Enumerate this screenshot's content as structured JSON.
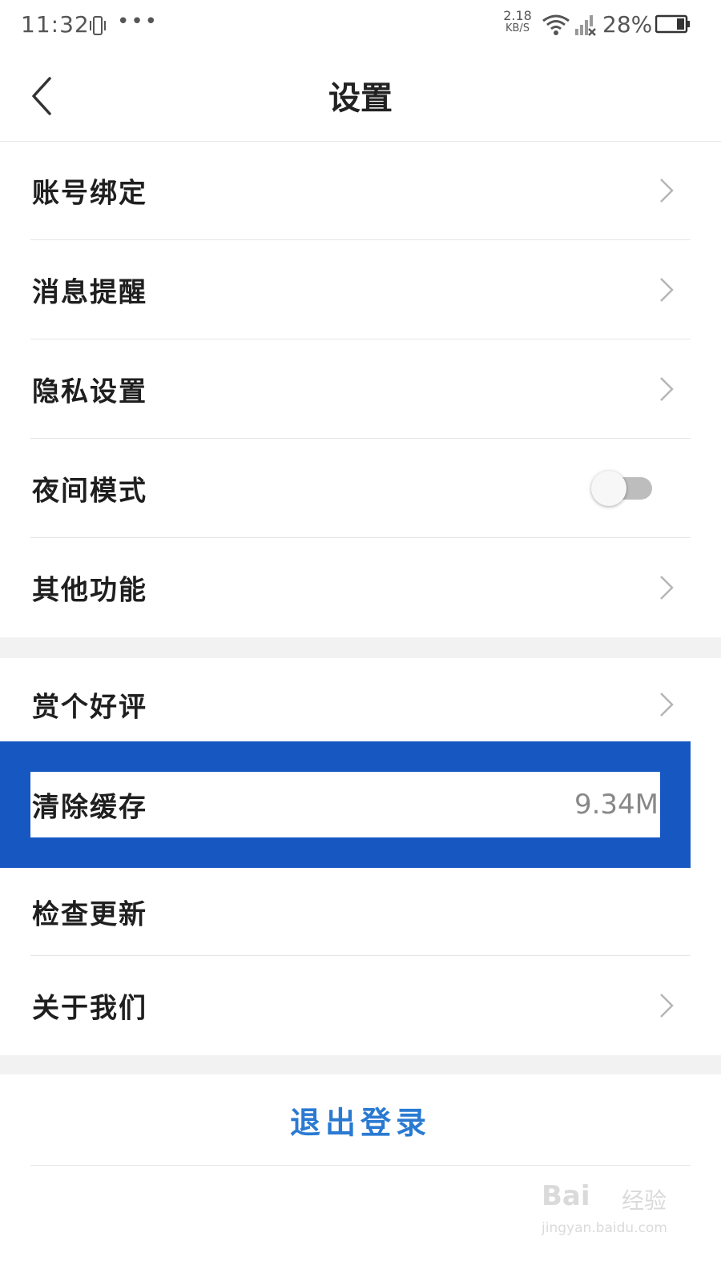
{
  "status_bar": {
    "time": "11:32",
    "dots": "•••",
    "net_speed_value": "2.18",
    "net_speed_unit": "KB/S",
    "battery_percent": "28%"
  },
  "header": {
    "title": "设置"
  },
  "groups": {
    "main": [
      {
        "label": "账号绑定"
      },
      {
        "label": "消息提醒"
      },
      {
        "label": "隐私设置"
      },
      {
        "label": "夜间模式",
        "toggle": "off"
      },
      {
        "label": "其他功能"
      }
    ],
    "secondary": [
      {
        "label": "赏个好评"
      },
      {
        "label": "清除缓存",
        "value": "9.34M"
      },
      {
        "label": "检查更新"
      },
      {
        "label": "关于我们"
      }
    ]
  },
  "logout": {
    "label": "退出登录"
  },
  "watermark": {
    "logo": "Bai",
    "cn": "经验",
    "url": "jingyan.baidu.com"
  },
  "colors": {
    "highlight": "#1657c2",
    "logout_text": "#2a7ad2",
    "separator_bg": "#f2f2f2"
  }
}
